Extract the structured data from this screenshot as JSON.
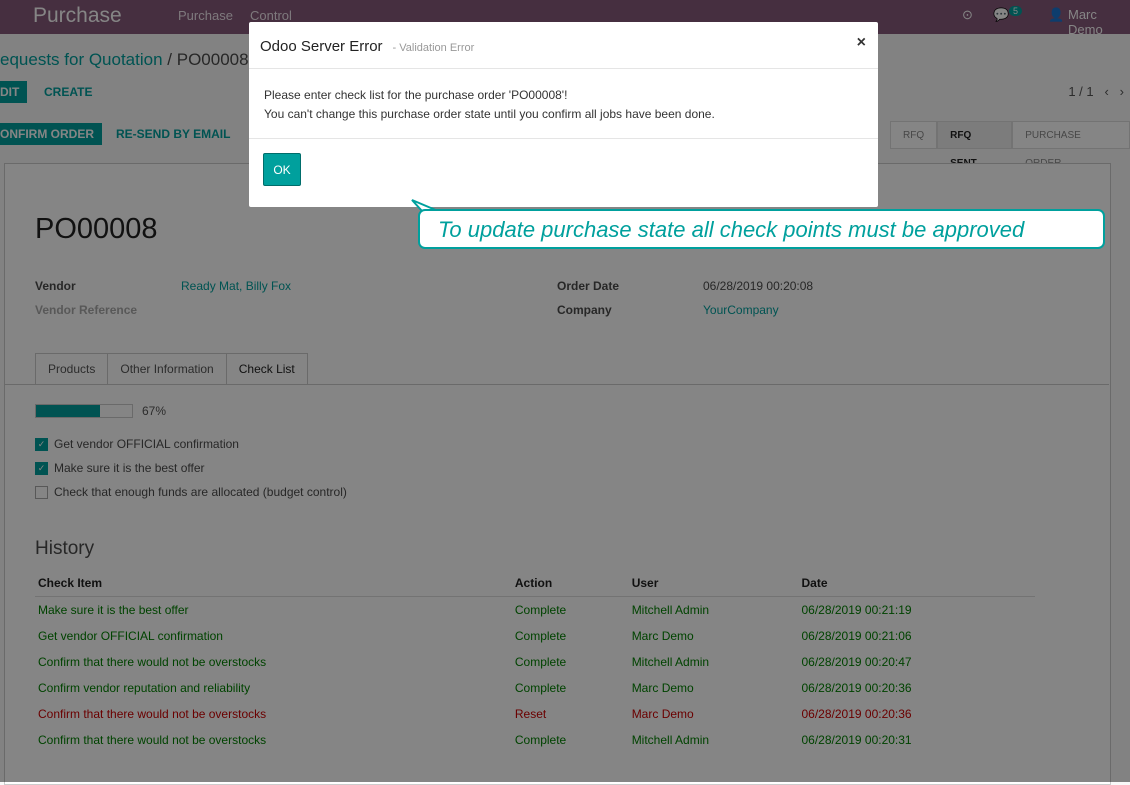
{
  "topbar": {
    "app_name": "Purchase",
    "menu": [
      "Purchase",
      "Control"
    ],
    "badge": "5",
    "user": "Marc Demo"
  },
  "breadcrumb": {
    "parent": "equests for Quotation",
    "separator": "/",
    "current": "PO00008"
  },
  "control": {
    "edit_label": "DIT",
    "create_label": "CREATE",
    "pager": "1 / 1"
  },
  "actions": {
    "confirm_label": "ONFIRM ORDER",
    "resend_label": "RE-SEND BY EMAIL"
  },
  "statusbar": {
    "stages": [
      "RFQ",
      "RFQ SENT",
      "PURCHASE ORDER"
    ],
    "active": "RFQ SENT"
  },
  "form": {
    "name": "PO00008",
    "vendor_label": "Vendor",
    "vendor_value": "Ready Mat, Billy Fox",
    "vendor_ref_label": "Vendor Reference",
    "order_date_label": "Order Date",
    "order_date_value": "06/28/2019 00:20:08",
    "company_label": "Company",
    "company_value": "YourCompany"
  },
  "tabs": [
    "Products",
    "Other Information",
    "Check List"
  ],
  "active_tab": "Check List",
  "checklist": {
    "progress": 0.67,
    "progress_text": "67%",
    "items": [
      {
        "label": "Get vendor OFFICIAL confirmation",
        "checked": true
      },
      {
        "label": "Make sure it is the best offer",
        "checked": true
      },
      {
        "label": "Check that enough funds are allocated (budget control)",
        "checked": false
      }
    ]
  },
  "history": {
    "title": "History",
    "columns": [
      "Check Item",
      "Action",
      "User",
      "Date"
    ],
    "rows": [
      [
        "Make sure it is the best offer",
        "Complete",
        "Mitchell Admin",
        "06/28/2019 00:21:19"
      ],
      [
        "Get vendor OFFICIAL confirmation",
        "Complete",
        "Marc Demo",
        "06/28/2019 00:21:06"
      ],
      [
        "Confirm that there would not be overstocks",
        "Complete",
        "Mitchell Admin",
        "06/28/2019 00:20:47"
      ],
      [
        "Confirm vendor reputation and reliability",
        "Complete",
        "Marc Demo",
        "06/28/2019 00:20:36"
      ],
      [
        "Confirm that there would not be overstocks",
        "Reset",
        "Marc Demo",
        "06/28/2019 00:20:36"
      ],
      [
        "Confirm that there would not be overstocks",
        "Complete",
        "Mitchell Admin",
        "06/28/2019 00:20:31"
      ]
    ]
  },
  "modal": {
    "title": "Odoo Server Error",
    "subtitle": "- Validation Error",
    "close": "×",
    "line1": "Please enter check list for the purchase order 'PO00008'!",
    "line2": "You can't change this purchase order state until you confirm all jobs have been done.",
    "ok_label": "OK"
  },
  "callout": {
    "text": "To update purchase state all check points must be approved"
  },
  "colors": {
    "brand": "#875a7b",
    "accent": "#00a09d",
    "complete": "#008000",
    "reset": "#cc0000"
  }
}
